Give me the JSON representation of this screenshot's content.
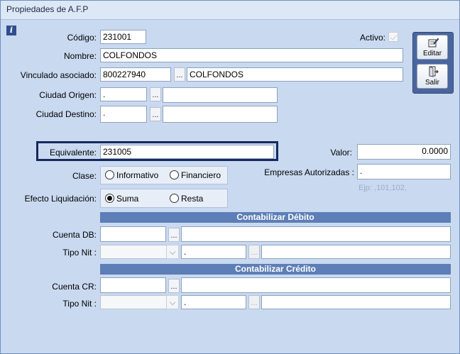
{
  "window": {
    "title": "Propiedades de A.F.P"
  },
  "icons": {
    "info": "info-icon",
    "edit": "edit-icon",
    "exit": "exit-door-icon"
  },
  "labels": {
    "codigo": "Código:",
    "nombre": "Nombre:",
    "vinculado": "Vinculado asociado:",
    "ciudad_origen": "Ciudad Origen:",
    "ciudad_destino": "Ciudad Destino:",
    "activo": "Activo:",
    "equivalente": "Equivalente:",
    "valor": "Valor:",
    "clase": "Clase:",
    "empresas": "Empresas Autorizadas :",
    "efecto": "Efecto Liquidación:",
    "cuenta_db": "Cuenta DB:",
    "tipo_nit_db": "Tipo Nit :",
    "cuenta_cr": "Cuenta CR:",
    "tipo_nit_cr": "Tipo Nit :"
  },
  "fields": {
    "codigo": "231001",
    "nombre": "COLFONDOS",
    "vinculado_code": "800227940",
    "vinculado_name": "COLFONDOS",
    "ciudad_origen_code": ".",
    "ciudad_origen_name": "",
    "ciudad_destino_code": ".",
    "ciudad_destino_name": "",
    "equivalente": "231005",
    "valor": "0.0000",
    "empresas": ".",
    "empresas_hint": "Ejp: ,101,102,",
    "cuenta_db_code": "",
    "cuenta_db_name": "",
    "tipo_nit_db_value": "",
    "tipo_nit_db_code": ".",
    "tipo_nit_db_name": "",
    "cuenta_cr_code": "",
    "cuenta_cr_name": "",
    "tipo_nit_cr_value": "",
    "tipo_nit_cr_code": ".",
    "tipo_nit_cr_name": ""
  },
  "activo_checked": true,
  "clase": {
    "options": [
      "Informativo",
      "Financiero"
    ],
    "selected": "none"
  },
  "efecto": {
    "options": [
      "Suma",
      "Resta"
    ],
    "selected": "Suma"
  },
  "sections": {
    "debito": "Contabilizar Débito",
    "credito": "Contabilizar Crédito"
  },
  "buttons": {
    "ellipsis": "...",
    "editar": "Editar",
    "salir": "Salir"
  },
  "colors": {
    "section_header": "#5d7eb6",
    "highlight_border": "#152a5c",
    "toolbar_bg": "#4a66a0"
  }
}
